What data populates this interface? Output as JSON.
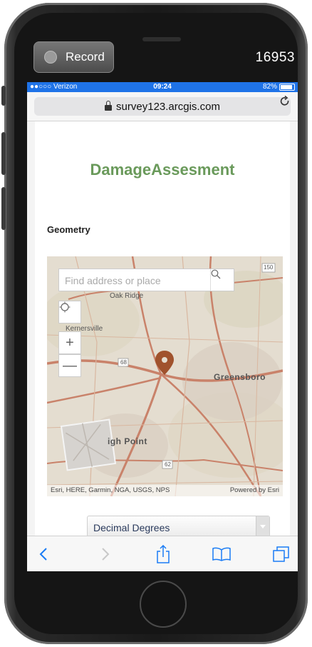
{
  "recording": {
    "button_label": "Record",
    "counter": "16953"
  },
  "status_bar": {
    "carrier": "●●○○○ Verizon",
    "time": "09:24",
    "battery": "82%"
  },
  "browser": {
    "url": "survey123.arcgis.com"
  },
  "form": {
    "title": "DamageAssesment",
    "geometry_label": "Geometry",
    "search_placeholder": "Find address or place",
    "map_labels": {
      "oak_ridge": "Oak Ridge",
      "kernersville": "Kernersville",
      "greensboro": "Greensboro",
      "high_point": "igh Point",
      "route_150": "150",
      "route_68": "68",
      "route_62": "62"
    },
    "attribution_left": "Esri, HERE, Garmin, NGA, USGS, NPS",
    "attribution_right": "Powered by Esri",
    "coordinate_format": "Decimal Degrees"
  },
  "colors": {
    "title": "#6a9a5b",
    "status_bar": "#1f73e8",
    "pin": "#a0522d",
    "toolbar_icon": "#1a7cf5"
  },
  "icons": {
    "lock": "lock-icon",
    "reload": "reload-icon",
    "search": "search-icon",
    "locate": "locate-icon",
    "zoom_in": "plus-icon",
    "zoom_out": "minus-icon",
    "pin": "map-pin-icon",
    "back": "chevron-left-icon",
    "forward": "chevron-right-icon",
    "share": "share-icon",
    "bookmarks": "book-icon",
    "tabs": "tabs-icon"
  }
}
